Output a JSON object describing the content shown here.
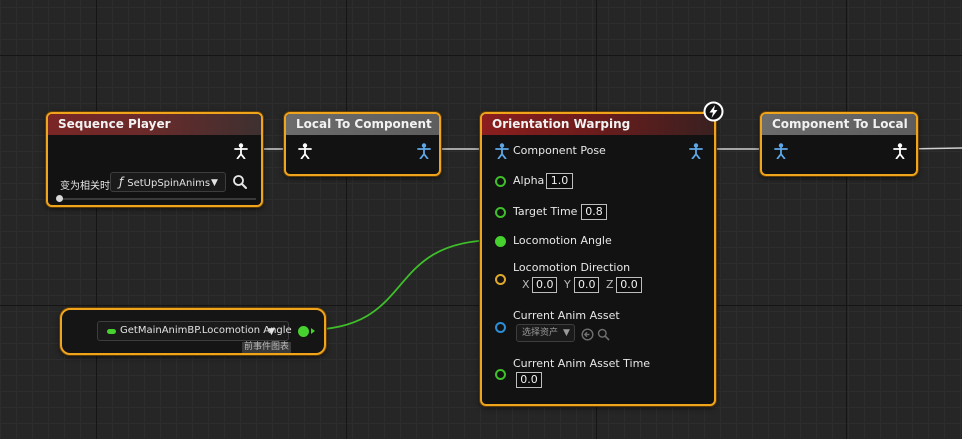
{
  "graph": {
    "sequence_player": {
      "title": "Sequence Player",
      "on_become_relevant_label": "变为相关时",
      "function_symbol": "ƒ",
      "function_name": "SetUpSpinAnims"
    },
    "local_to_component": {
      "title": "Local To Component"
    },
    "orientation_warping": {
      "title": "Orientation Warping",
      "component_pose_label": "Component Pose",
      "alpha_label": "Alpha",
      "alpha_value": "1.0",
      "target_time_label": "Target Time",
      "target_time_value": "0.8",
      "locomotion_angle_label": "Locomotion Angle",
      "locomotion_direction_label": "Locomotion Direction",
      "x_label": "X",
      "x_value": "0.0",
      "y_label": "Y",
      "y_value": "0.0",
      "z_label": "Z",
      "z_value": "0.0",
      "current_anim_asset_label": "Current Anim Asset",
      "select_asset_label": "选择资产",
      "current_anim_asset_time_label": "Current Anim Asset Time",
      "current_anim_asset_time_value": "0.0"
    },
    "component_to_local": {
      "title": "Component To Local"
    },
    "property_access": {
      "binding": "GetMainAnimBP.Locomotion Angle",
      "footer": "前事件图表"
    }
  },
  "colors": {
    "node_border_selected": "#f0a41c",
    "pose_pin_white": "#ffffff",
    "pose_pin_blue": "#5fa8e8",
    "float_pin": "#46d12e",
    "vector_pin": "#e0a92b",
    "object_pin": "#2b8ed6"
  }
}
